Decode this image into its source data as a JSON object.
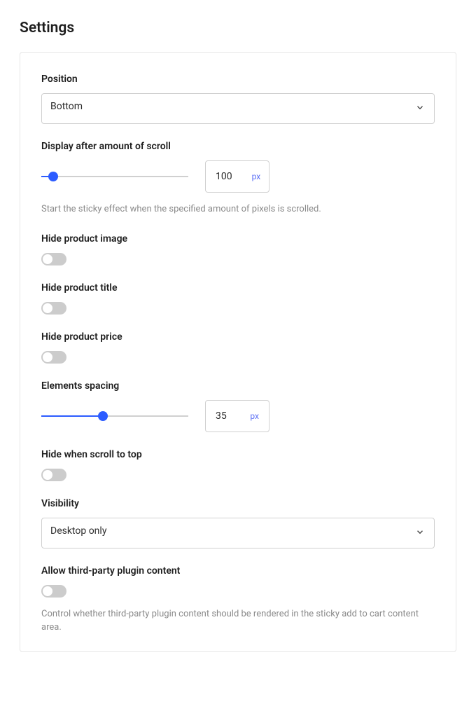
{
  "title": "Settings",
  "fields": {
    "position": {
      "label": "Position",
      "value": "Bottom"
    },
    "scroll": {
      "label": "Display after amount of scroll",
      "value": "100",
      "unit": "px",
      "percent": 8,
      "help": "Start the sticky effect when the specified amount of pixels is scrolled."
    },
    "hideImage": {
      "label": "Hide product image",
      "on": false
    },
    "hideTitle": {
      "label": "Hide product title",
      "on": false
    },
    "hidePrice": {
      "label": "Hide product price",
      "on": false
    },
    "spacing": {
      "label": "Elements spacing",
      "value": "35",
      "unit": "px",
      "percent": 42
    },
    "hideScrollTop": {
      "label": "Hide when scroll to top",
      "on": false
    },
    "visibility": {
      "label": "Visibility",
      "value": "Desktop only"
    },
    "thirdParty": {
      "label": "Allow third-party plugin content",
      "on": false,
      "help": "Control whether third-party plugin content should be rendered in the sticky add to cart content area."
    }
  }
}
